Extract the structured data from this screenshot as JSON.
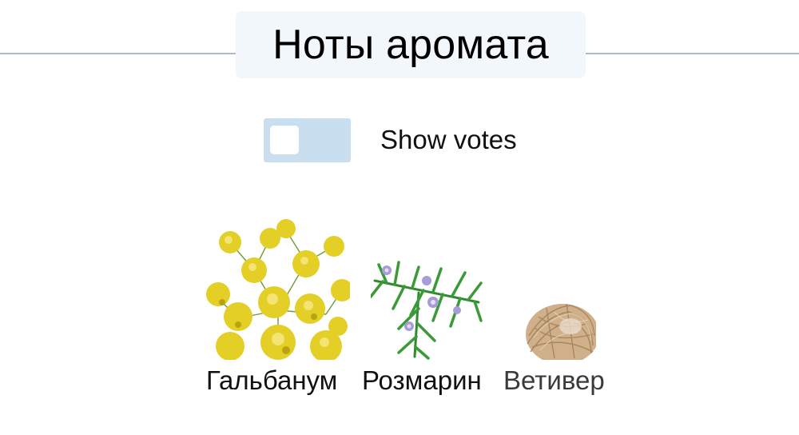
{
  "section": {
    "title": "Ноты аромата"
  },
  "votes_toggle": {
    "label": "Show votes",
    "state": "off"
  },
  "notes": [
    {
      "name": "Гальбанум",
      "icon": "galbanum-flower-icon"
    },
    {
      "name": "Розмарин",
      "icon": "rosemary-sprig-icon"
    },
    {
      "name": "Ветивер",
      "icon": "vetiver-root-icon"
    }
  ],
  "colors": {
    "rule": "#a9bccd",
    "title_bg": "#f2f7fc",
    "toggle_bg": "#c9dff0",
    "galbanum_yellow": "#e8d12a",
    "rosemary_green": "#2f8a2f",
    "vetiver_tan": "#c9a880"
  }
}
